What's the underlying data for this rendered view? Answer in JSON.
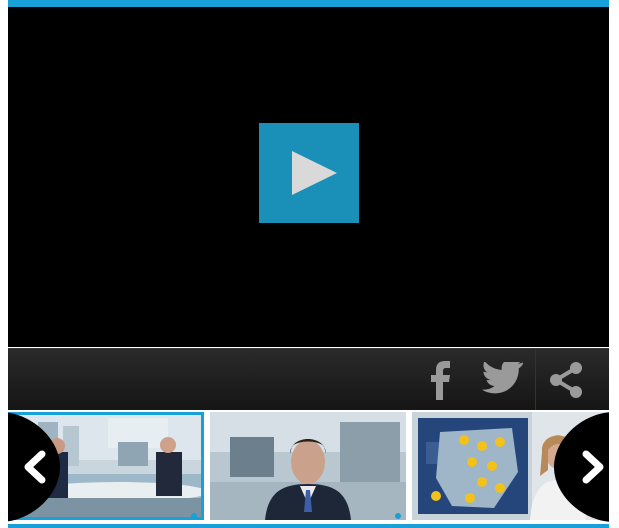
{
  "player": {
    "accent_color": "#1aa0d8",
    "play_icon": "play-icon"
  },
  "share": {
    "items": [
      {
        "icon": "facebook-icon"
      },
      {
        "icon": "twitter-icon"
      },
      {
        "icon": "share-icon"
      }
    ]
  },
  "carousel": {
    "prev_icon": "chevron-left-icon",
    "next_icon": "chevron-right-icon",
    "thumbnails": [
      {
        "scene": "news-studio-interview",
        "active": true
      },
      {
        "scene": "news-anchor",
        "active": false
      },
      {
        "scene": "weather-map",
        "active": false
      }
    ]
  }
}
